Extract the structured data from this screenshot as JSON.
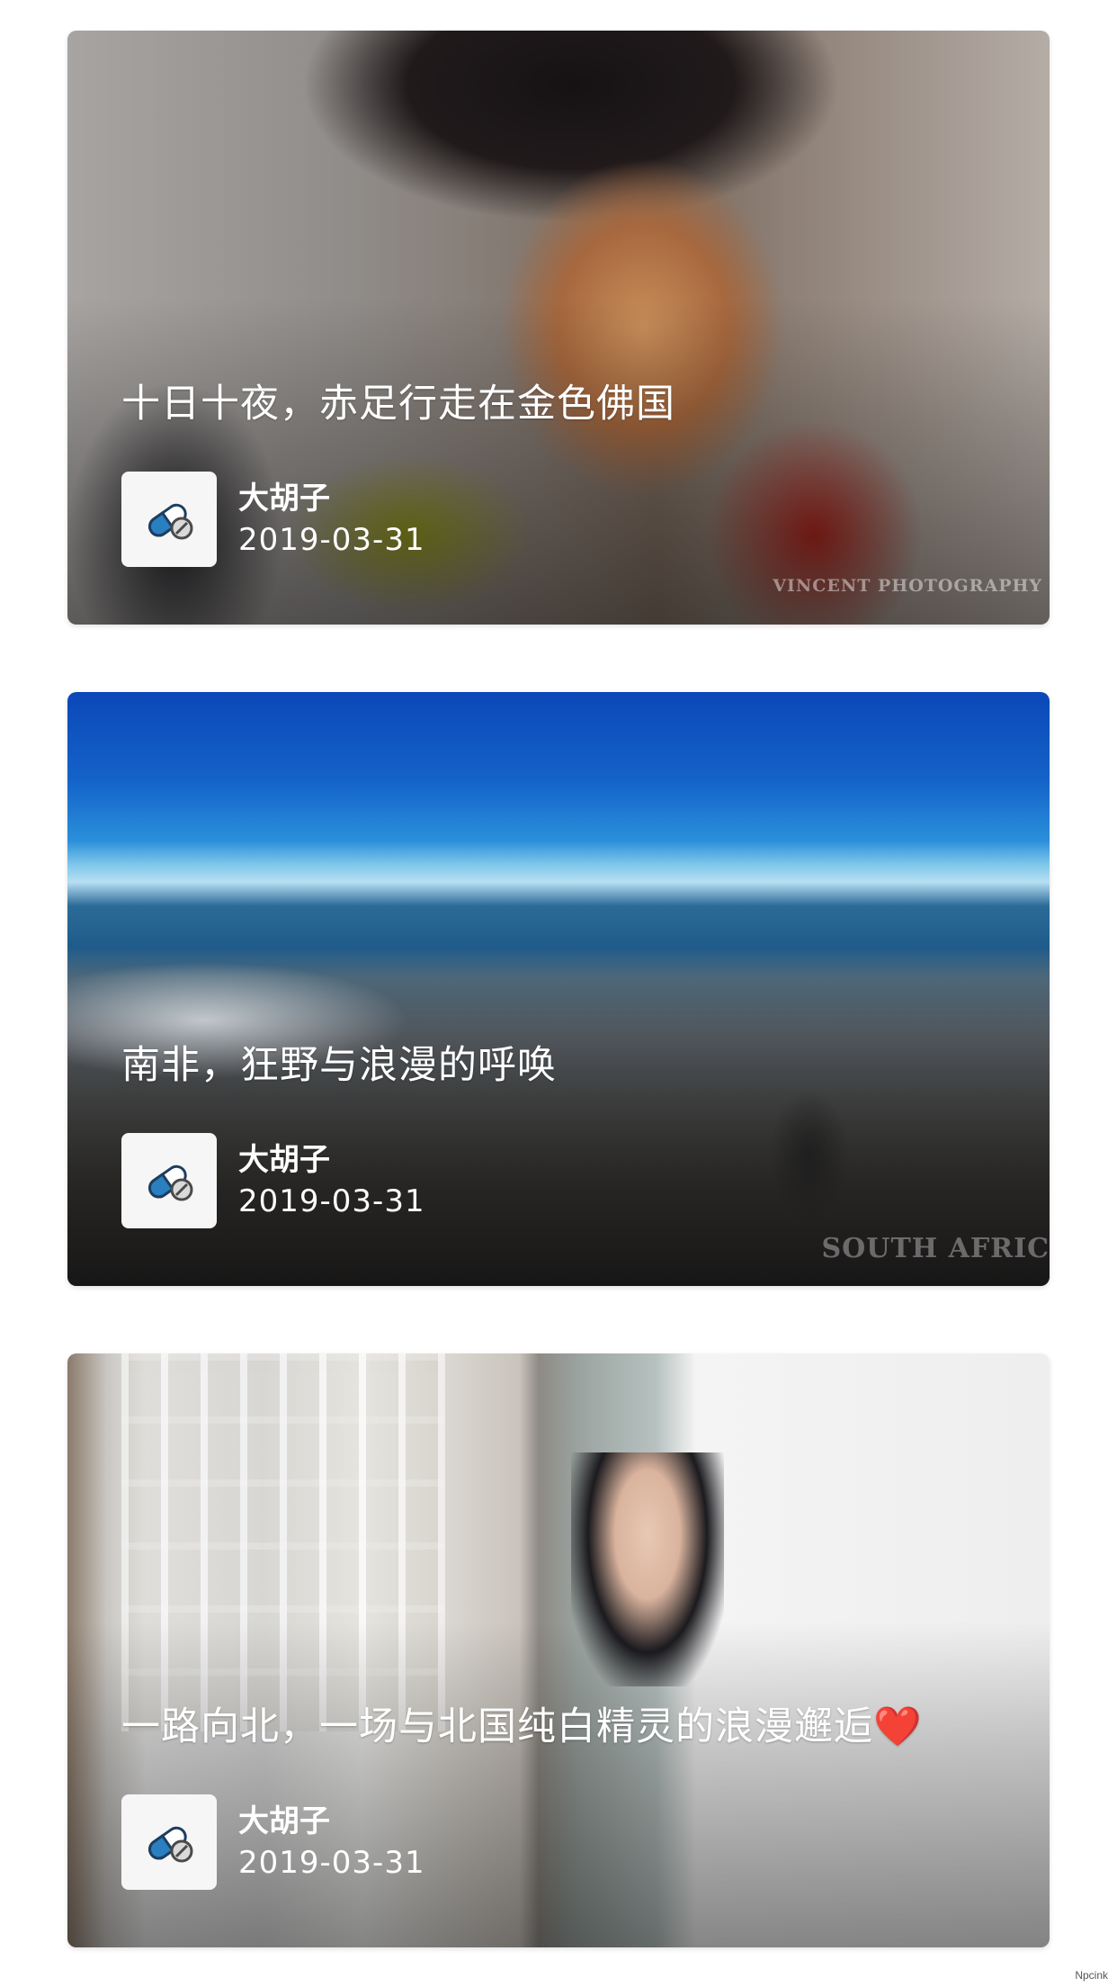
{
  "posts": [
    {
      "title": "十日十夜，赤足行走在金色佛国",
      "author": "大胡子",
      "date": "2019-03-31",
      "watermark": "VINCENT PHOTOGRAPHY"
    },
    {
      "title": "南非，狂野与浪漫的呼唤",
      "author": "大胡子",
      "date": "2019-03-31",
      "watermark": "SOUTH AFRIC"
    },
    {
      "title": "一路向北，一场与北国纯白精灵的浪漫邂逅❤️",
      "author": "大胡子",
      "date": "2019-03-31"
    }
  ],
  "footer": {
    "mark": "Npcink"
  },
  "avatar_icon": "pill-capsule-icon",
  "colors": {
    "text_overlay": "#ffffff",
    "avatar_bg": "#f6f6f6",
    "capsule_blue": "#2a7fc1"
  }
}
